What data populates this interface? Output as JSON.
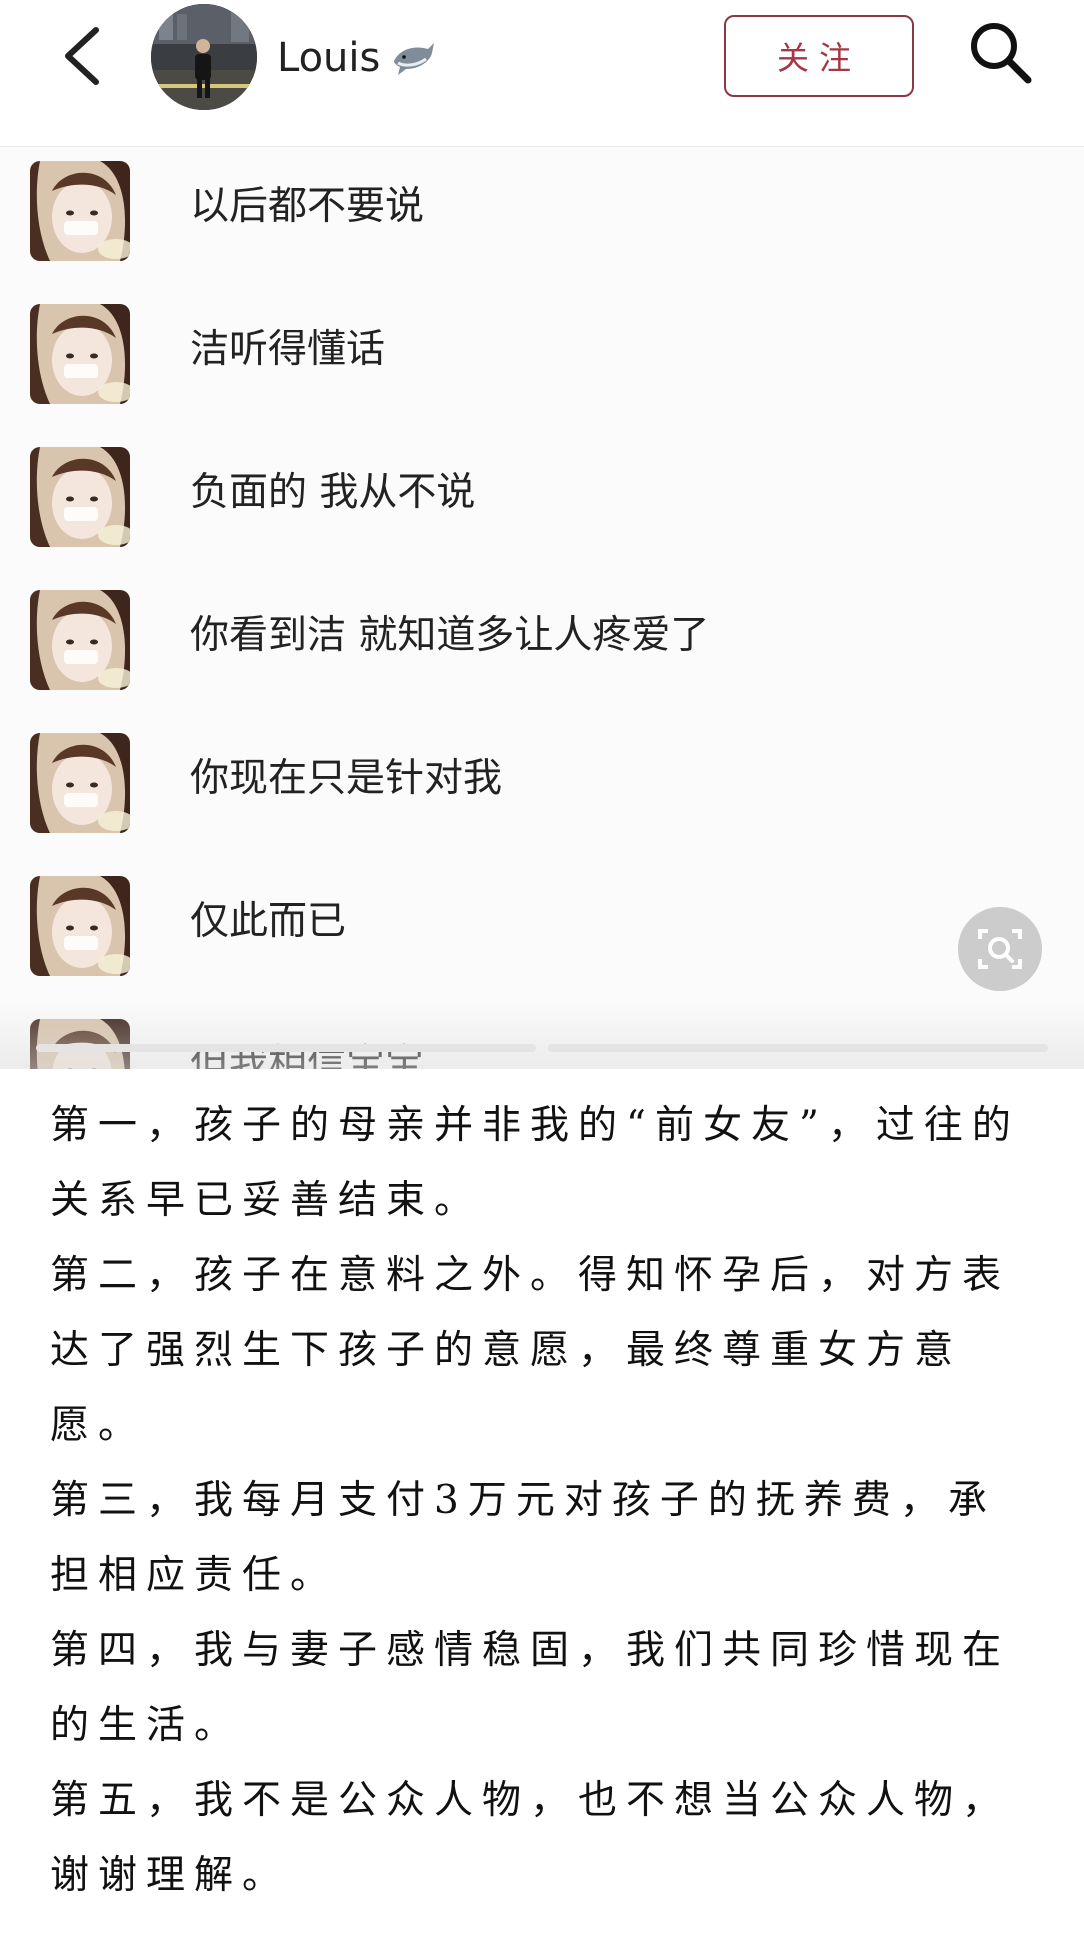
{
  "header": {
    "user_name": "Louis",
    "follow_label": "关注"
  },
  "chat": {
    "messages": [
      "以后都不要说",
      "洁听得懂话",
      "负面的 我从不说",
      "你看到洁 就知道多让人疼爱了",
      "你现在只是针对我",
      "仅此而已",
      "但我相信宝宝"
    ]
  },
  "statement": {
    "paragraphs": [
      "第一，孩子的母亲并非我的“前女友”，过往的关系早已妥善结束。",
      "第二，孩子在意料之外。得知怀孕后，对方表达了强烈生下孩子的意愿，最终尊重女方意愿。",
      "第三，我每月支付3万元对孩子的抚养费，承担相应责任。",
      "第四，我与妻子感情稳固，我们共同珍惜现在的生活。",
      "第五，我不是公众人物，也不想当公众人物，谢谢理解。"
    ]
  },
  "icons": {
    "back": "chevron-left-icon",
    "search": "search-icon",
    "emoji": "shark-icon",
    "scan": "image-search-icon"
  },
  "colors": {
    "follow_border": "#8a3a44",
    "follow_text": "#a53745"
  }
}
